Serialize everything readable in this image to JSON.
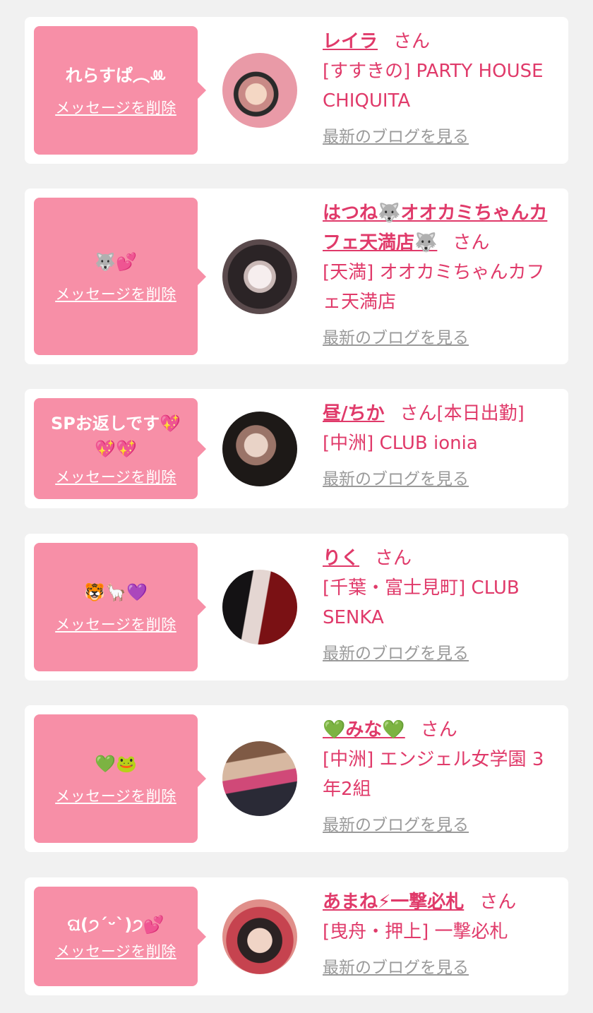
{
  "cards": [
    {
      "message": "れらすぱ︵ꔛ",
      "delete_label": "メッセージを削除",
      "name": "レイラ",
      "san": "さん",
      "suffix": "",
      "shop": "[すすきの] PARTY HOUSE CHIQUITA",
      "blog_label": "最新のブログを見る"
    },
    {
      "message": "🐺💕",
      "delete_label": "メッセージを削除",
      "name": "はつね🐺オオカミちゃんカフェ天満店🐺",
      "san": "さん",
      "suffix": "",
      "shop": "[天満] オオカミちゃんカフェ天満店",
      "blog_label": "最新のブログを見る"
    },
    {
      "message": "SPお返しです💖💖💖",
      "delete_label": "メッセージを削除",
      "name": "昼/ちか",
      "san": "さん",
      "suffix": "[本日出勤]",
      "shop": "[中洲] CLUB ionia",
      "blog_label": "最新のブログを見る"
    },
    {
      "message": "🐯🦙💜",
      "delete_label": "メッセージを削除",
      "name": "りく",
      "san": "さん",
      "suffix": "",
      "shop": "[千葉・富士見町] CLUB SENKA",
      "blog_label": "最新のブログを見る"
    },
    {
      "message": "💚🐸",
      "delete_label": "メッセージを削除",
      "name": "💚みな💚",
      "san": "さん",
      "suffix": "",
      "shop": "[中洲] エンジェル女学園 3年2組",
      "blog_label": "最新のブログを見る"
    },
    {
      "message": "ଘ(੭ˊᵕˋ)੭💕",
      "delete_label": "メッセージを削除",
      "name": "あまね⚡一撃必札",
      "san": "さん",
      "suffix": "",
      "shop": "[曳舟・押上] 一撃必札",
      "blog_label": "最新のブログを見る"
    }
  ]
}
